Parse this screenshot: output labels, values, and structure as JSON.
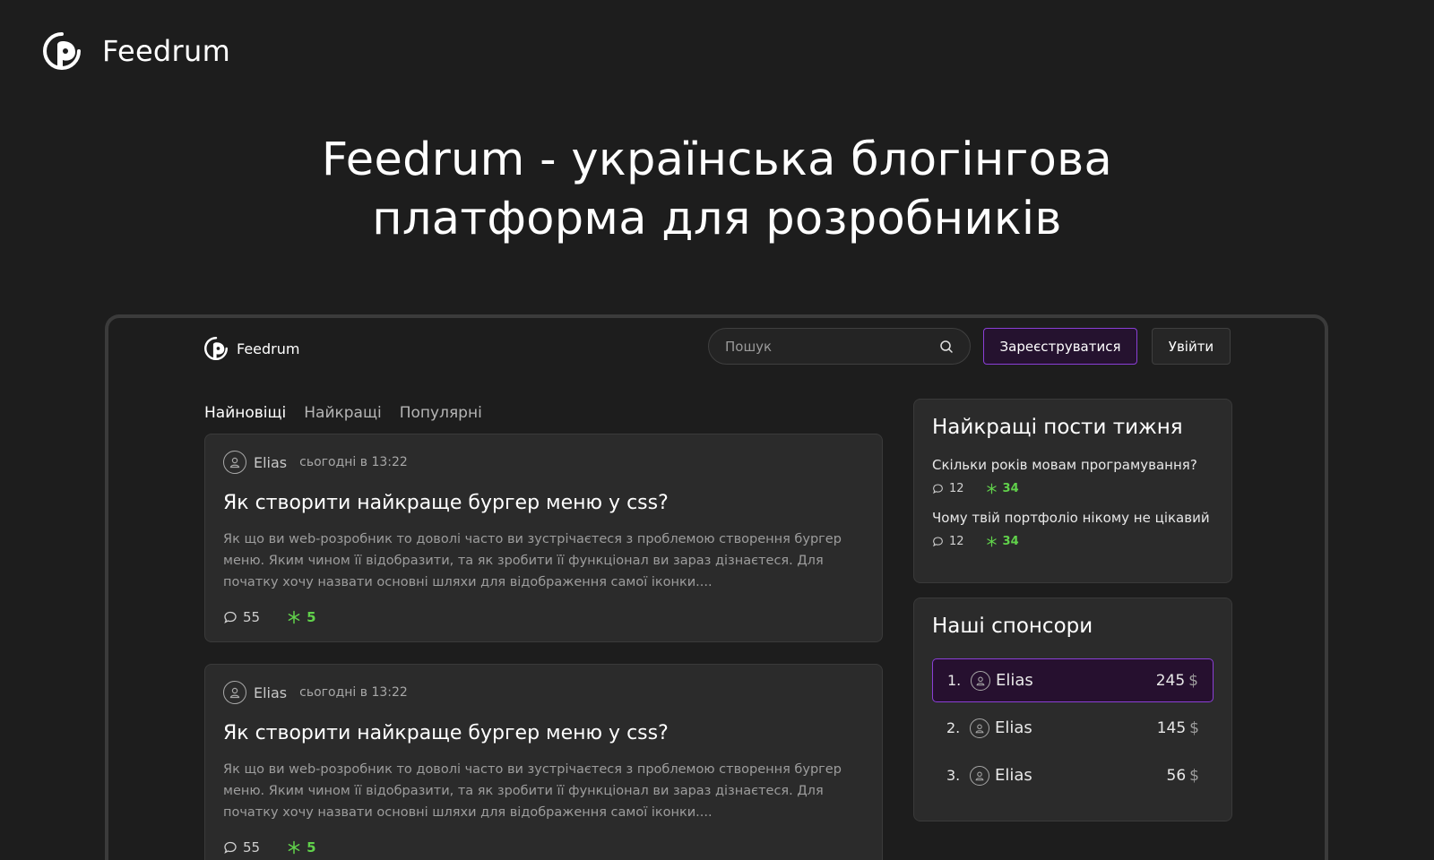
{
  "brand": {
    "name": "Feedrum"
  },
  "hero": {
    "line1": "Feedrum - українська блогінгова",
    "line2": "платформа для розробників"
  },
  "preview": {
    "brand": "Feedrum",
    "search": {
      "placeholder": "Пошук"
    },
    "register_label": "Зареєструватися",
    "login_label": "Увійти",
    "tabs": [
      {
        "label": "Найновіщі",
        "active": true
      },
      {
        "label": "Найкращі",
        "active": false
      },
      {
        "label": "Популярні",
        "active": false
      }
    ],
    "posts": [
      {
        "author": "Elias",
        "date": "сьогодні в 13:22",
        "title": "Як створити найкраще бургер меню у css?",
        "excerpt": "Як що ви web-розробник то доволі часто ви зустрічаєтеся з проблемою створення бургер меню. Яким чином її відобразити, та як зробити її функціонал ви зараз дізнаєтеся. Для початку хочу назвати основні шляхи для відображення самої іконки....",
        "comments": "55",
        "likes": "5"
      },
      {
        "author": "Elias",
        "date": "сьогодні в 13:22",
        "title": "Як створити найкраще бургер меню у css?",
        "excerpt": "Як що ви web-розробник то доволі часто ви зустрічаєтеся з проблемою створення бургер меню. Яким чином її відобразити, та як зробити її функціонал ви зараз дізнаєтеся. Для початку хочу назвати основні шляхи для відображення самої іконки....",
        "comments": "55",
        "likes": "5"
      }
    ],
    "top_posts": {
      "title": "Найкращі пости тижня",
      "items": [
        {
          "title": "Скільки років мовам програмування?",
          "comments": "12",
          "likes": "34"
        },
        {
          "title": "Чому твій портфоліо нікому не цікавий",
          "comments": "12",
          "likes": "34"
        }
      ]
    },
    "sponsors": {
      "title": "Наші  спонсори",
      "items": [
        {
          "rank": "1.",
          "name": "Elias",
          "amount": "245",
          "currency": "$"
        },
        {
          "rank": "2.",
          "name": "Elias",
          "amount": "145",
          "currency": "$"
        },
        {
          "rank": "3.",
          "name": "Elias",
          "amount": "56",
          "currency": "$"
        }
      ]
    }
  },
  "colors": {
    "background": "#1d1d1d",
    "card": "#2b2b2b",
    "accent": "#8a3fd6",
    "likes": "#61d24b"
  }
}
